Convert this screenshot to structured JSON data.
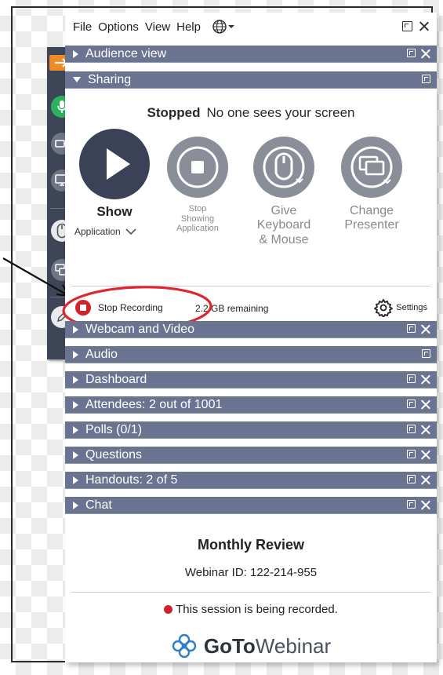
{
  "menu": {
    "file": "File",
    "options": "Options",
    "view": "View",
    "help": "Help",
    "language_icon": "globe-icon"
  },
  "sections": {
    "audience_view": "Audience view",
    "sharing": "Sharing",
    "webcam": "Webcam and Video",
    "audio": "Audio",
    "dashboard": "Dashboard",
    "attendees": "Attendees: 2 out of 1001",
    "polls": "Polls (0/1)",
    "questions": "Questions",
    "handouts": "Handouts: 2 of 5",
    "chat": "Chat"
  },
  "sharing": {
    "status_label": "Stopped",
    "status_text": "No one sees your screen",
    "show_label": "Show",
    "show_select": "Application",
    "stop_line1": "Stop",
    "stop_line2": "Showing",
    "stop_line3": "Application",
    "give_line1": "Give",
    "give_line2": "Keyboard",
    "give_line3": "& Mouse",
    "change_line1": "Change",
    "change_line2": "Presenter"
  },
  "recording": {
    "stop_label": "Stop Recording",
    "remaining": "2.2 GB remaining",
    "settings_label": "Settings"
  },
  "footer": {
    "title": "Monthly Review",
    "webinar_id": "Webinar ID: 122-214-955",
    "recording_notice": "This session is being recorded.",
    "brand_goto": "GoTo",
    "brand_webinar": "Webinar"
  },
  "colors": {
    "header_bg": "#6a7491",
    "toolbar_bg": "#3e4556",
    "play_button": "#3b4257",
    "gray_button": "#7d828d",
    "mic_green": "#2db15f",
    "arrow_orange": "#f08a24",
    "record_red": "#d0222a",
    "annotation_red": "#e0262d"
  }
}
